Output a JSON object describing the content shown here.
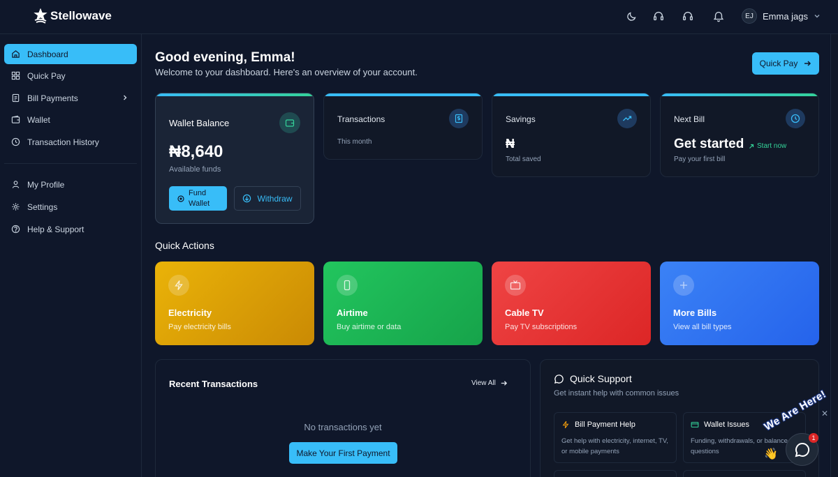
{
  "app": {
    "name": "Stellowave"
  },
  "topbar": {
    "user_initials": "EJ",
    "user_name": "Emma jags"
  },
  "sidebar": {
    "items": [
      {
        "label": "Dashboard",
        "active": true
      },
      {
        "label": "Quick Pay"
      },
      {
        "label": "Bill Payments"
      },
      {
        "label": "Wallet"
      },
      {
        "label": "Transaction History"
      },
      {
        "label": "My Profile"
      },
      {
        "label": "Settings"
      },
      {
        "label": "Help & Support"
      }
    ]
  },
  "header": {
    "greeting": "Good evening, Emma!",
    "subtitle": "Welcome to your dashboard. Here's an overview of your account.",
    "quick_pay_label": "Quick Pay"
  },
  "cards": {
    "wallet": {
      "title": "Wallet Balance",
      "amount": "₦8,640",
      "caption": "Available funds",
      "fund_label": "Fund Wallet",
      "withdraw_label": "Withdraw"
    },
    "transactions": {
      "title": "Transactions",
      "caption": "This month"
    },
    "savings": {
      "title": "Savings",
      "amount": "₦",
      "caption": "Total saved"
    },
    "next_bill": {
      "title": "Next Bill",
      "headline": "Get started",
      "link": "Start now",
      "caption": "Pay your first bill"
    }
  },
  "quick_actions": {
    "title": "Quick Actions",
    "items": [
      {
        "title": "Electricity",
        "desc": "Pay electricity bills",
        "color": "#eab308"
      },
      {
        "title": "Airtime",
        "desc": "Buy airtime or data",
        "color": "#22c55e"
      },
      {
        "title": "Cable TV",
        "desc": "Pay TV subscriptions",
        "color": "#ef4444"
      },
      {
        "title": "More Bills",
        "desc": "View all bill types",
        "color": "#3b82f6"
      }
    ]
  },
  "recent": {
    "title": "Recent Transactions",
    "view_all": "View All",
    "empty": "No transactions yet",
    "cta": "Make Your First Payment"
  },
  "support": {
    "title": "Quick Support",
    "subtitle": "Get instant help with common issues",
    "cards": [
      {
        "title": "Bill Payment Help",
        "desc": "Get help with electricity, internet, TV, or mobile payments"
      },
      {
        "title": "Wallet Issues",
        "desc": "Funding, withdrawals, or balance questions"
      }
    ]
  },
  "chat": {
    "badge": "1",
    "banner": "We Are Here!"
  },
  "colors": {
    "accent": "#38bdf8",
    "background": "#0f172a",
    "card": "#111827"
  }
}
